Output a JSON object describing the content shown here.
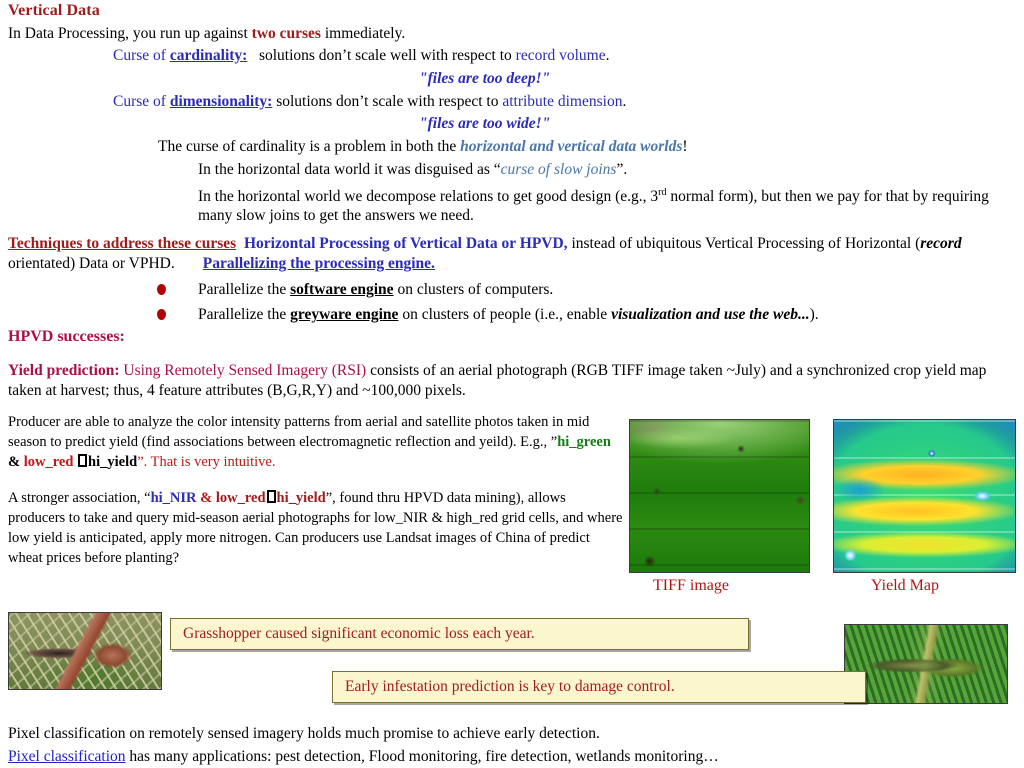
{
  "slide": {
    "title": "Vertical Data",
    "intro": {
      "pre": "In Data Processing, you run up against ",
      "emph": "two curses",
      "post": " immediately."
    },
    "curses": [
      {
        "lead": "Curse of ",
        "term": "cardinality:",
        "rest": "solutions don’t scale well with respect to ",
        "object": "record volume",
        "tail": ".",
        "quip": "\"files are too deep!\""
      },
      {
        "lead": "Curse of ",
        "term": "dimensionality:",
        "rest": "solutions don’t scale with respect to ",
        "object": "attribute dimension",
        "tail": ".",
        "quip": "\"files are too wide!\""
      }
    ],
    "both_worlds": {
      "pre": "The curse of cardinality is a problem in both the ",
      "emph": "horizontal and vertical data worlds",
      "post": "!"
    },
    "disguised": {
      "pre": "In the horizontal data world it was disguised as “",
      "emph": "curse of slow joins",
      "post": "”."
    },
    "horizontal_note": {
      "part1": "In the horizontal world we decompose relations to get good design (e.g., 3",
      "ordinal": "rd",
      "part2": " normal form), but then we pay for that by requiring many slow joins to get the answers we need."
    },
    "techniques": {
      "header": "Techniques to address these curses",
      "hpvd": "Horizontal Processing of Vertical Data or HPVD,",
      "body1": " instead of ubiquitous Vertical Processing of Horizontal (",
      "record": "record",
      "body2": " orientated) Data or VPHD.",
      "parallelizing": "Parallelizing the processing engine.",
      "bullets": [
        {
          "pre": "Parallelize the ",
          "term": "software engine",
          "post": " on clusters of computers."
        },
        {
          "pre": "Parallelize the ",
          "term": "greyware engine",
          "post": " on clusters of people   (i.e., enable ",
          "emph": "visualization and use the web...",
          "tail": ")."
        }
      ]
    },
    "hpvd_successes": "HPVD successes:",
    "yield_prediction": {
      "label": "Yield prediction:",
      "rsi": " Using Remotely Sensed Imagery (RSI)",
      "body": " consists of an aerial photograph (RGB TIFF image taken ~July) and a synchronized crop yield map taken at harvest; thus, 4 feature attributes (B,G,R,Y) and ~100,000 pixels."
    },
    "producer_para_1": {
      "part1": "Producer are able to analyze the color intensity patterns from aerial and satellite photos taken in mid season to predict yield (find associations between electromagnetic reflection and yeild). E.g., ”",
      "hi_green": "hi_green",
      "amp": " & ",
      "low_red": "low_red",
      "hi_yield": "hi_yield",
      "part2": "”.  That is very intuitive."
    },
    "producer_para_2": {
      "part1": "A stronger association, “",
      "hi_nir": "hi_NIR",
      "amp": " & ",
      "low_red": "low_red",
      "hi_yield": "hi_yield",
      "part2": "”, found thru HPVD data mining), allows producers to take and query mid-season aerial photographs for low_NIR & high_red grid cells, and where low yield is anticipated, apply more nitrogen. Can producers use Landsat images of China of predict wheat prices before planting?"
    },
    "images": {
      "tiff_caption": "TIFF image",
      "yield_caption": "Yield Map"
    },
    "callouts": [
      "Grasshopper caused significant economic loss each year.",
      "Early infestation prediction is key to damage control."
    ],
    "bottom": {
      "line1": "Pixel classification on remotely sensed imagery holds much promise to achieve early detection.",
      "link": "Pixel classification",
      "line2_rest": " has many applications: pest detection, Flood monitoring, fire detection,  wetlands monitoring…"
    }
  },
  "colors": {
    "title_red": "#9e1b1b",
    "crimson": "#aa1144",
    "blue": "#2b2bbb",
    "steel_blue": "#4a77a8",
    "green": "#167d16",
    "red": "#c01818",
    "link_blue": "#2222cc",
    "callout_bg": "#fbf6cd",
    "callout_border": "#7a7034",
    "callout_text": "#a01e1e"
  }
}
